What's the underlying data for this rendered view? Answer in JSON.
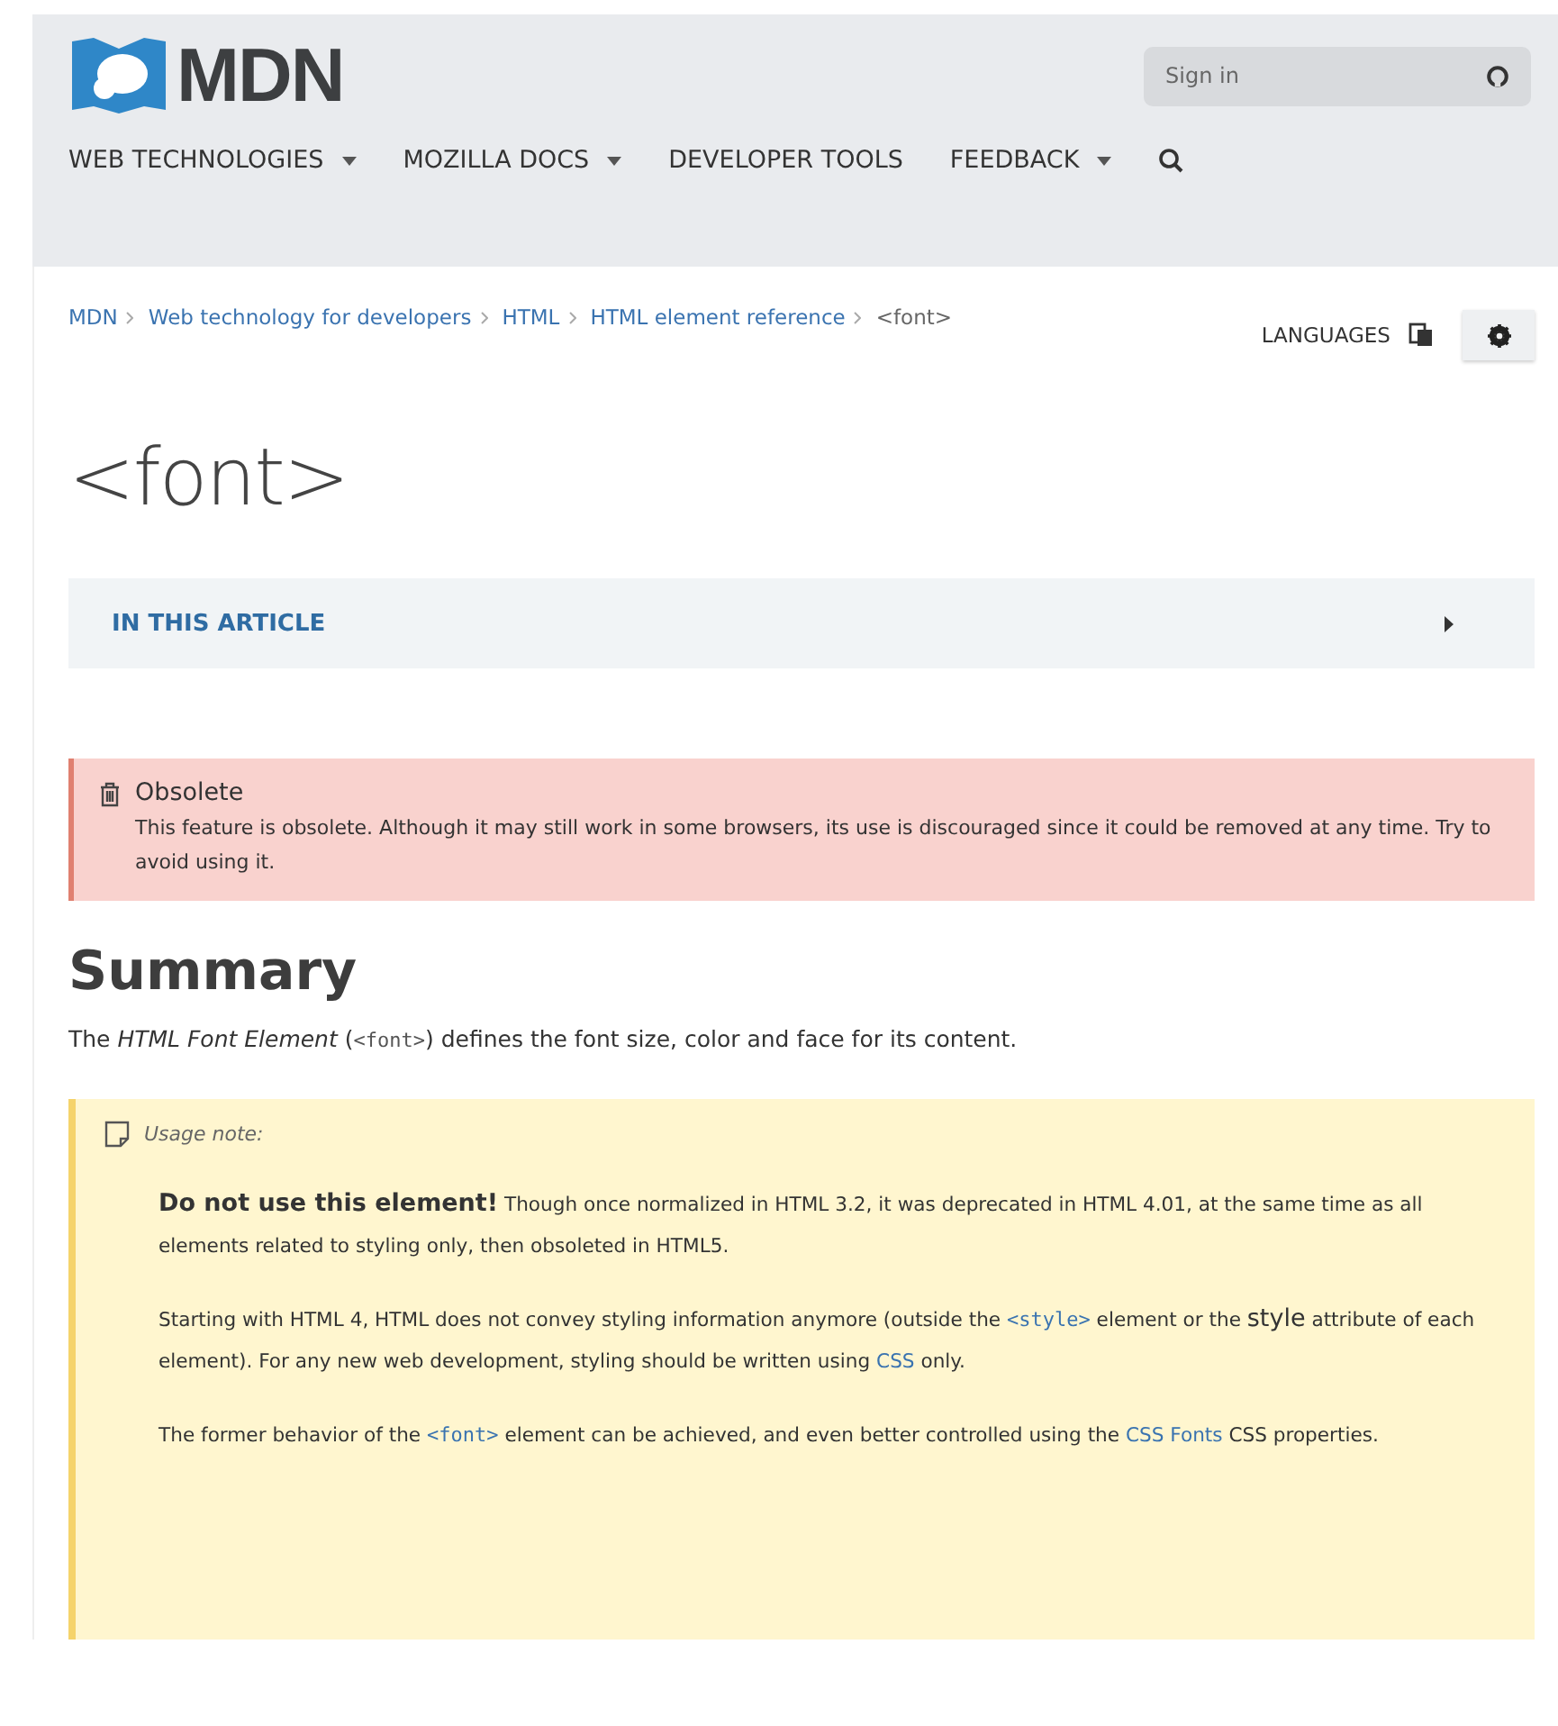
{
  "header": {
    "logo": "MDN",
    "search": {
      "placeholder": "Sign in"
    },
    "nav": [
      {
        "label": "WEB TECHNOLOGIES",
        "dropdown": true
      },
      {
        "label": "MOZILLA DOCS",
        "dropdown": true
      },
      {
        "label": "DEVELOPER TOOLS",
        "dropdown": false
      },
      {
        "label": "FEEDBACK",
        "dropdown": true
      }
    ]
  },
  "breadcrumbs": [
    {
      "label": "MDN",
      "link": true
    },
    {
      "label": "Web technology for developers",
      "link": true
    },
    {
      "label": "HTML",
      "link": true
    },
    {
      "label": "HTML element reference",
      "link": true
    },
    {
      "label": "<font>",
      "link": false
    }
  ],
  "languages": "LANGUAGES",
  "title": "<font>",
  "toc": {
    "label": "IN THIS ARTICLE",
    "expanded": false
  },
  "obsolete": {
    "title": "Obsolete",
    "text": "This feature is obsolete. Although it may still work in some browsers, its use is discouraged since it could be removed at any time. Try to avoid using it."
  },
  "summary": {
    "heading": "Summary",
    "paragraph": [
      {
        "kind": "text",
        "text": "The "
      },
      {
        "kind": "em",
        "text": "HTML Font Element"
      },
      {
        "kind": "text",
        "text": " ("
      },
      {
        "kind": "code",
        "text": "<font>"
      },
      {
        "kind": "text",
        "text": ") defines the font size, color and face for its content."
      }
    ]
  },
  "note": {
    "label": "Usage note:",
    "paragraphs": [
      [
        {
          "kind": "strong",
          "text": "Do not use this element!"
        },
        {
          "kind": "text",
          "text": " Though once normalized in HTML 3.2, it was deprecated in HTML 4.01, at the same time as all elements related to styling only, then obsoleted in HTML5."
        }
      ],
      [
        {
          "kind": "text",
          "text": "Starting with HTML 4, HTML does not convey styling information anymore (outside the "
        },
        {
          "kind": "code",
          "text": "<style>"
        },
        {
          "kind": "text",
          "text": " element or the "
        },
        {
          "kind": "strong",
          "text": "style"
        },
        {
          "kind": "text",
          "text": " attribute of each element). For any new web development, styling should be written using "
        },
        {
          "kind": "link",
          "text": "CSS"
        },
        {
          "kind": "text",
          "text": " only."
        }
      ],
      [
        {
          "kind": "text",
          "text": "The former behavior of the "
        },
        {
          "kind": "code",
          "text": "<font>"
        },
        {
          "kind": "text",
          "text": " element can be achieved, and even better controlled using the "
        },
        {
          "kind": "link",
          "text": "CSS Fonts"
        },
        {
          "kind": "text",
          "text": " CSS properties."
        }
      ]
    ]
  }
}
